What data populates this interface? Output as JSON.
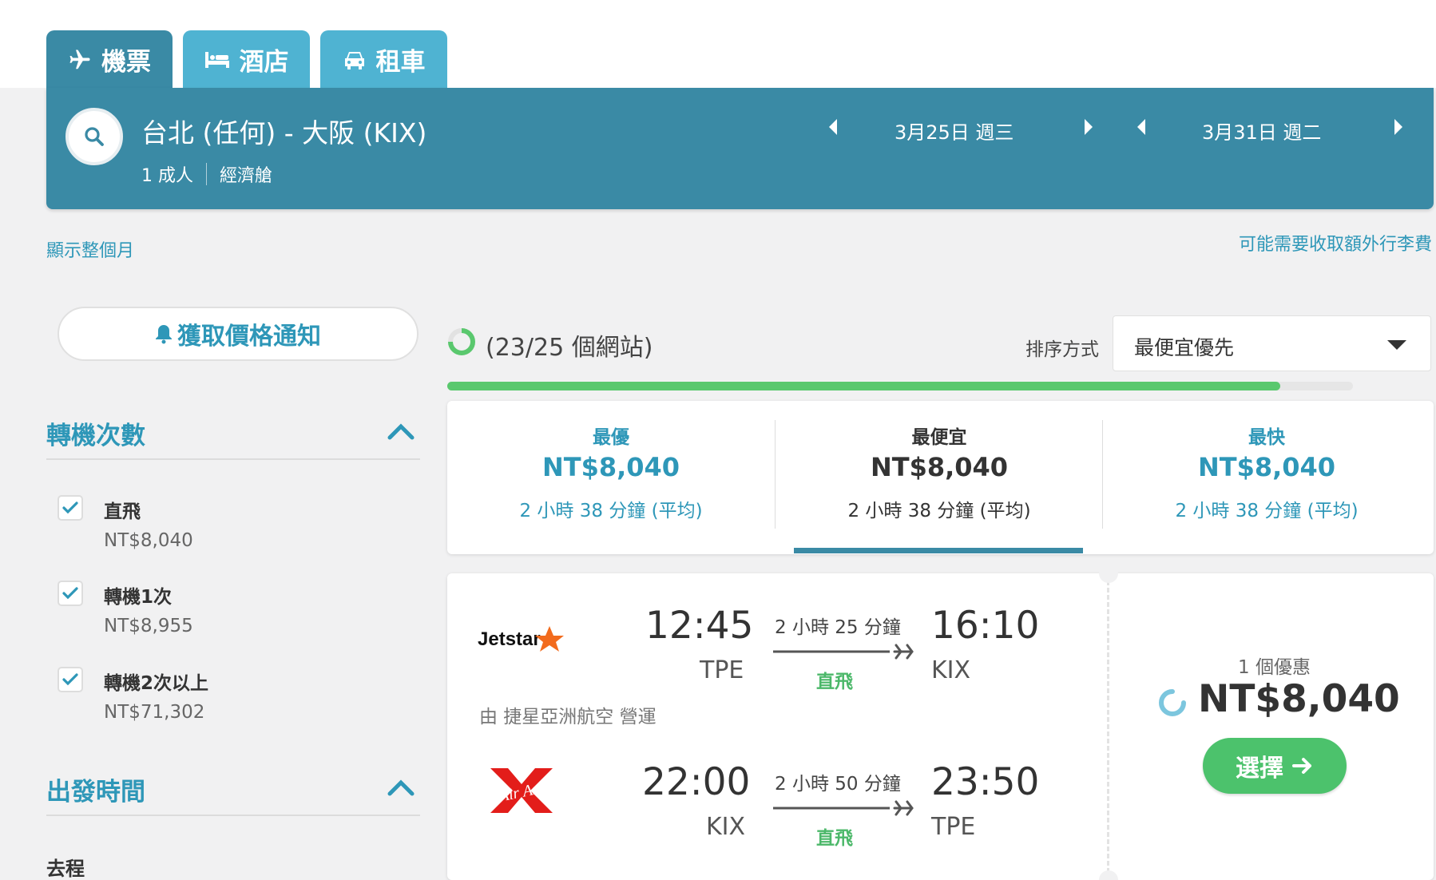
{
  "tabs": [
    {
      "label": "機票",
      "icon": "plane-icon",
      "active": true
    },
    {
      "label": "酒店",
      "icon": "bed-icon",
      "active": false
    },
    {
      "label": "租車",
      "icon": "car-icon",
      "active": false
    }
  ],
  "search": {
    "route": "台北 (任何) - 大阪 (KIX)",
    "passengers": "1 成人",
    "cabin": "經濟艙",
    "depart_date": "3月25日 週三",
    "return_date": "3月31日 週二"
  },
  "links": {
    "show_month": "顯示整個月",
    "baggage_note": "可能需要收取額外行李費"
  },
  "alert_button": "獲取價格通知",
  "filters": {
    "stops_title": "轉機次數",
    "options": [
      {
        "label": "直飛",
        "price": "NT$8,040",
        "checked": true
      },
      {
        "label": "轉機1次",
        "price": "NT$8,955",
        "checked": true
      },
      {
        "label": "轉機2次以上",
        "price": "NT$71,302",
        "checked": true
      }
    ],
    "departure_title": "出發時間",
    "outbound_label": "去程"
  },
  "results_header": {
    "sites_status": "(23/25 個網站)",
    "progress": 0.92,
    "sort_label": "排序方式",
    "sort_value": "最便宜優先"
  },
  "summary": [
    {
      "label": "最優",
      "price": "NT$8,040",
      "duration": "2 小時 38 分鐘 (平均)",
      "selected": false
    },
    {
      "label": "最便宜",
      "price": "NT$8,040",
      "duration": "2 小時 38 分鐘 (平均)",
      "selected": true
    },
    {
      "label": "最快",
      "price": "NT$8,040",
      "duration": "2 小時 38 分鐘 (平均)",
      "selected": false
    }
  ],
  "result": {
    "outbound": {
      "airline_logo": "Jetstar",
      "dep_time": "12:45",
      "dep_code": "TPE",
      "duration": "2 小時 25 分鐘",
      "stops": "直飛",
      "arr_time": "16:10",
      "arr_code": "KIX"
    },
    "operated_by": "由 捷星亞洲航空 營運",
    "inbound": {
      "airline_logo": "Air Asia",
      "dep_time": "22:00",
      "dep_code": "KIX",
      "duration": "2 小時 50 分鐘",
      "stops": "直飛",
      "arr_time": "23:50",
      "arr_code": "TPE"
    },
    "deals_count": "1 個優惠",
    "price": "NT$8,040",
    "select_label": "選擇"
  },
  "colors": {
    "primary": "#3a8aa5",
    "tab_inactive": "#4fb3d2",
    "link": "#2e97b8",
    "green": "#4cc26c"
  }
}
